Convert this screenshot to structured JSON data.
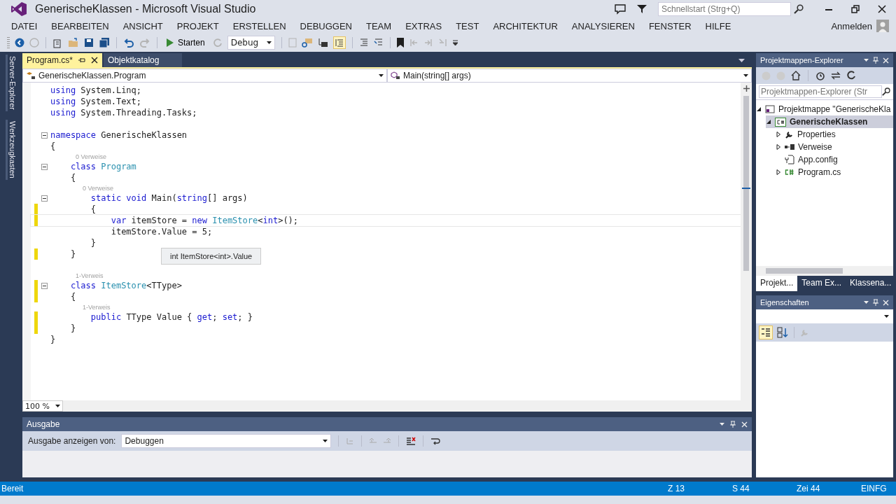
{
  "window": {
    "title": "GenerischeKlassen - Microsoft Visual Studio"
  },
  "quick_launch": {
    "placeholder": "Schnellstart (Strg+Q)"
  },
  "menu": [
    "DATEI",
    "BEARBEITEN",
    "ANSICHT",
    "PROJEKT",
    "ERSTELLEN",
    "DEBUGGEN",
    "TEAM",
    "EXTRAS",
    "TEST",
    "ARCHITEKTUR",
    "ANALYSIEREN",
    "FENSTER",
    "HILFE"
  ],
  "account": {
    "label": "Anmelden"
  },
  "toolbar": {
    "start_label": "Starten",
    "configuration": "Debug"
  },
  "side_tabs": [
    "Server-Explorer",
    "Werkzeugkasten"
  ],
  "document_tabs": [
    {
      "label": "Program.cs*",
      "selected": true
    },
    {
      "label": "Objektkatalog",
      "selected": false
    }
  ],
  "nav_bar": {
    "type_scope": "GenerischeKlassen.Program",
    "member_scope": "Main(string[] args)"
  },
  "code": [
    {
      "kind": "code",
      "fold": false,
      "changed": false,
      "current": false,
      "tokens": [
        {
          "kind": "keyword",
          "text": "using"
        },
        {
          "kind": "plain",
          "text": " System.Linq;"
        }
      ]
    },
    {
      "kind": "code",
      "fold": false,
      "changed": false,
      "current": false,
      "tokens": [
        {
          "kind": "keyword",
          "text": "using"
        },
        {
          "kind": "plain",
          "text": " System.Text;"
        }
      ]
    },
    {
      "kind": "code",
      "fold": false,
      "changed": false,
      "current": false,
      "tokens": [
        {
          "kind": "keyword",
          "text": "using"
        },
        {
          "kind": "plain",
          "text": " System.Threading.Tasks;"
        }
      ]
    },
    {
      "kind": "blank"
    },
    {
      "kind": "code",
      "fold": true,
      "changed": false,
      "current": false,
      "tokens": [
        {
          "kind": "keyword",
          "text": "namespace"
        },
        {
          "kind": "plain",
          "text": " GenerischeKlassen"
        }
      ]
    },
    {
      "kind": "code",
      "fold": false,
      "changed": false,
      "current": false,
      "tokens": [
        {
          "kind": "plain",
          "text": "{"
        }
      ]
    },
    {
      "kind": "hint",
      "text": "    0 Verweise"
    },
    {
      "kind": "code",
      "fold": true,
      "changed": false,
      "current": false,
      "tokens": [
        {
          "kind": "keyword",
          "text": "    class "
        },
        {
          "kind": "type",
          "text": "Program"
        }
      ]
    },
    {
      "kind": "code",
      "fold": false,
      "changed": false,
      "current": false,
      "tokens": [
        {
          "kind": "plain",
          "text": "    {"
        }
      ]
    },
    {
      "kind": "hint",
      "text": "        0 Verweise"
    },
    {
      "kind": "code",
      "fold": true,
      "changed": false,
      "current": false,
      "tokens": [
        {
          "kind": "keyword",
          "text": "        static void"
        },
        {
          "kind": "plain",
          "text": " Main("
        },
        {
          "kind": "keyword",
          "text": "string"
        },
        {
          "kind": "plain",
          "text": "[] args)"
        }
      ]
    },
    {
      "kind": "code",
      "fold": false,
      "changed": true,
      "current": false,
      "tokens": [
        {
          "kind": "plain",
          "text": "        {"
        }
      ]
    },
    {
      "kind": "code",
      "fold": false,
      "changed": true,
      "current": true,
      "tokens": [
        {
          "kind": "keyword",
          "text": "            var"
        },
        {
          "kind": "plain",
          "text": " itemStore = "
        },
        {
          "kind": "keyword",
          "text": "new "
        },
        {
          "kind": "type",
          "text": "ItemStore"
        },
        {
          "kind": "plain",
          "text": "<"
        },
        {
          "kind": "keyword",
          "text": "int"
        },
        {
          "kind": "plain",
          "text": ">();"
        }
      ]
    },
    {
      "kind": "code",
      "fold": false,
      "changed": false,
      "current": false,
      "tokens": [
        {
          "kind": "plain",
          "text": "            itemStore.Value = 5;"
        }
      ]
    },
    {
      "kind": "code",
      "fold": false,
      "changed": false,
      "current": false,
      "tokens": [
        {
          "kind": "plain",
          "text": "        }"
        }
      ]
    },
    {
      "kind": "code",
      "fold": false,
      "changed": true,
      "current": false,
      "tokens": [
        {
          "kind": "plain",
          "text": "    }"
        }
      ]
    },
    {
      "kind": "blank"
    },
    {
      "kind": "hint",
      "text": "    1-Verweis"
    },
    {
      "kind": "code",
      "fold": true,
      "changed": true,
      "current": false,
      "tokens": [
        {
          "kind": "keyword",
          "text": "    class "
        },
        {
          "kind": "type",
          "text": "ItemStore"
        },
        {
          "kind": "plain",
          "text": "<TType>"
        }
      ]
    },
    {
      "kind": "code",
      "fold": false,
      "changed": true,
      "current": false,
      "tokens": [
        {
          "kind": "plain",
          "text": "    {"
        }
      ]
    },
    {
      "kind": "hint",
      "text": "        1-Verweis"
    },
    {
      "kind": "code",
      "fold": false,
      "changed": true,
      "current": false,
      "tokens": [
        {
          "kind": "keyword",
          "text": "        public"
        },
        {
          "kind": "plain",
          "text": " TType Value { "
        },
        {
          "kind": "keyword",
          "text": "get"
        },
        {
          "kind": "plain",
          "text": "; "
        },
        {
          "kind": "keyword",
          "text": "set"
        },
        {
          "kind": "plain",
          "text": "; }"
        }
      ]
    },
    {
      "kind": "code",
      "fold": false,
      "changed": true,
      "current": false,
      "tokens": [
        {
          "kind": "plain",
          "text": "    }"
        }
      ]
    },
    {
      "kind": "code",
      "fold": false,
      "changed": false,
      "current": false,
      "tokens": [
        {
          "kind": "plain",
          "text": "}"
        }
      ]
    }
  ],
  "tooltip": "int ItemStore<int>.Value",
  "zoom": "100 %",
  "output": {
    "title": "Ausgabe",
    "show_from_label": "Ausgabe anzeigen von:",
    "source": "Debuggen"
  },
  "solution_explorer": {
    "title": "Projektmappen-Explorer",
    "search_placeholder": "Projektmappen-Explorer (Str",
    "tree": [
      {
        "label": "Projektmappe \"GenerischeKla",
        "kind": "solution",
        "expanded": true,
        "selected": false,
        "children": [
          {
            "label": "GenerischeKlassen",
            "kind": "project",
            "expanded": true,
            "selected": true,
            "children": [
              {
                "label": "Properties",
                "kind": "properties",
                "expanded": false,
                "selected": false
              },
              {
                "label": "Verweise",
                "kind": "references",
                "expanded": false,
                "selected": false
              },
              {
                "label": "App.config",
                "kind": "config",
                "selected": false
              },
              {
                "label": "Program.cs",
                "kind": "csfile",
                "expanded": false,
                "selected": false
              }
            ]
          }
        ]
      }
    ],
    "tabs": [
      {
        "label": "Projekt...",
        "selected": true
      },
      {
        "label": "Team Ex...",
        "selected": false
      },
      {
        "label": "Klassena...",
        "selected": false
      }
    ]
  },
  "properties": {
    "title": "Eigenschaften"
  },
  "status_bar": {
    "message": "Bereit",
    "line": "Z 13",
    "column": "S 44",
    "char": "Zei 44",
    "mode": "EINFG"
  }
}
